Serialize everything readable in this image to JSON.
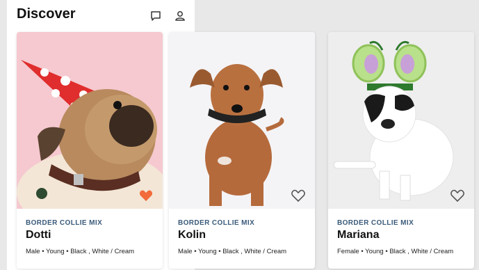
{
  "header": {
    "title": "Discover",
    "icons": [
      "chat-icon",
      "user-icon"
    ]
  },
  "colors": {
    "favorite_active": "#f26b3a",
    "favorite_inactive": "#555555",
    "breed_label": "#3a5a7a"
  },
  "cards": [
    {
      "breed": "BORDER COLLIE MIX",
      "name": "Dotti",
      "details": "Male • Young • Black , White / Cream",
      "favorited": true
    },
    {
      "breed": "BORDER COLLIE MIX",
      "name": "Kolin",
      "details": "Male • Young • Black , White / Cream",
      "favorited": false
    },
    {
      "breed": "BORDER COLLIE MIX",
      "name": "Mariana",
      "details": "Female • Young • Black , White / Cream",
      "favorited": false
    }
  ]
}
